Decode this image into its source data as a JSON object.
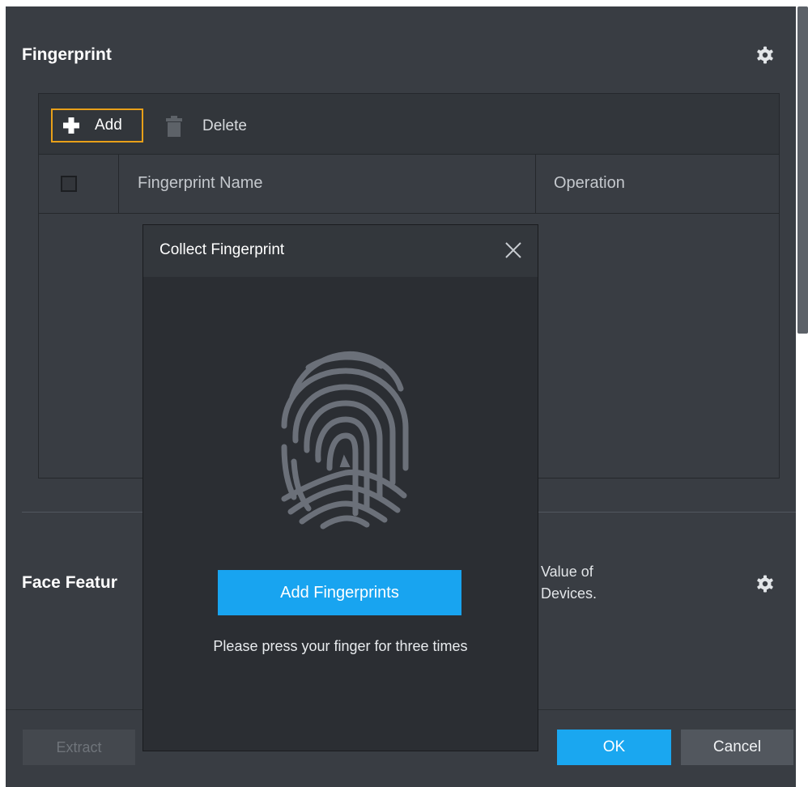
{
  "fingerprint_section": {
    "title": "Fingerprint",
    "toolbar": {
      "add_label": "Add",
      "delete_label": "Delete"
    },
    "columns": [
      "Fingerprint Name",
      "Operation"
    ]
  },
  "face_section": {
    "title": "Face Featur",
    "hint_lines": [
      "Value of",
      "Devices."
    ]
  },
  "footer": {
    "extract_label": "Extract",
    "ok_label": "OK",
    "cancel_label": "Cancel"
  },
  "modal": {
    "title": "Collect Fingerprint",
    "button_label": "Add Fingerprints",
    "instruction": "Please press your finger for three times"
  },
  "colors": {
    "panel_bg": "#393d43",
    "modal_bg": "#2b2e33",
    "accent_blue": "#1aa7f0",
    "focus_orange": "#e8a019"
  },
  "icons": [
    "gear-icon",
    "plus-icon",
    "trash-icon",
    "close-icon",
    "fingerprint-icon"
  ]
}
